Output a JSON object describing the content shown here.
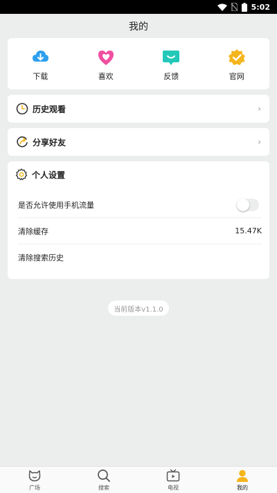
{
  "status_bar": {
    "time": "5:02"
  },
  "header": {
    "title": "我的"
  },
  "quick_actions": [
    {
      "label": "下载",
      "icon": "download-icon",
      "color": "#2ea0ee"
    },
    {
      "label": "喜欢",
      "icon": "heart-icon",
      "color": "#f04fa0"
    },
    {
      "label": "反馈",
      "icon": "feedback-icon",
      "color": "#23c8b8"
    },
    {
      "label": "官网",
      "icon": "badge-check-icon",
      "color": "#f5b51c"
    }
  ],
  "history": {
    "label": "历史观看",
    "icon": "clock-icon"
  },
  "share": {
    "label": "分享好友",
    "icon": "share-icon"
  },
  "settings": {
    "title": "个人设置",
    "icon": "gear-icon",
    "mobile_data_label": "是否允许使用手机流量",
    "mobile_data_enabled": false,
    "clear_cache_label": "清除缓存",
    "cache_size": "15.47K",
    "clear_search_label": "清除搜索历史"
  },
  "version": "当前版本v1.1.0",
  "tabs": [
    {
      "label": "广场",
      "icon": "cat-face-icon"
    },
    {
      "label": "搜索",
      "icon": "search-icon"
    },
    {
      "label": "电视",
      "icon": "tv-icon"
    },
    {
      "label": "我的",
      "icon": "user-icon"
    }
  ],
  "colors": {
    "accent": "#f5b51c",
    "background": "#eceeed"
  }
}
